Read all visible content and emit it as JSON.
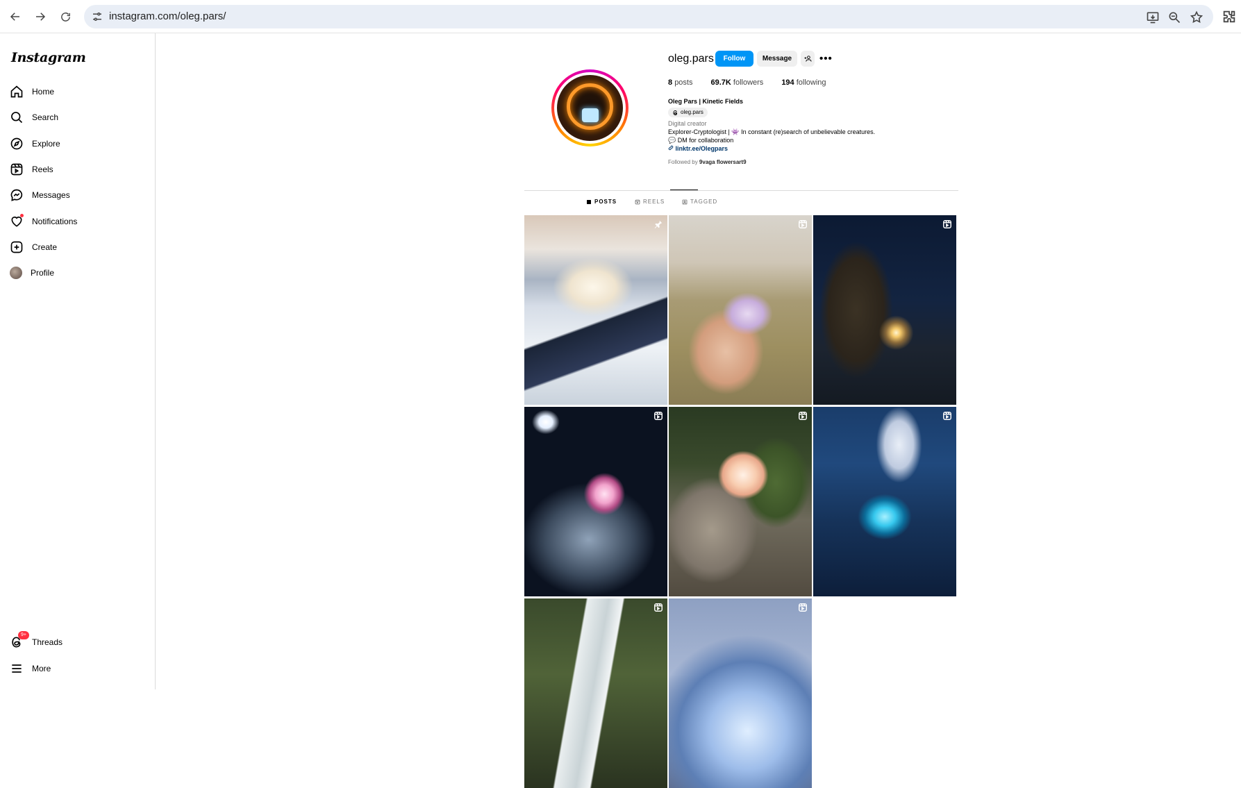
{
  "browser": {
    "url": "instagram.com/oleg.pars/"
  },
  "sidebar": {
    "logo": "Instagram",
    "items": [
      {
        "label": "Home"
      },
      {
        "label": "Search"
      },
      {
        "label": "Explore"
      },
      {
        "label": "Reels"
      },
      {
        "label": "Messages"
      },
      {
        "label": "Notifications"
      },
      {
        "label": "Create"
      },
      {
        "label": "Profile"
      }
    ],
    "threads": {
      "label": "Threads",
      "badge": "9+"
    },
    "more": {
      "label": "More"
    }
  },
  "profile": {
    "username": "oleg.pars",
    "follow_label": "Follow",
    "message_label": "Message",
    "add_label": "+A",
    "more_label": "•••",
    "stats": {
      "posts_count": "8",
      "posts_label": "posts",
      "followers_count": "69.7K",
      "followers_label": "followers",
      "following_count": "194",
      "following_label": "following"
    },
    "bio": {
      "name": "Oleg Pars | Kinetic Fields",
      "threads_handle": "oleg.pars",
      "category": "Digital creator",
      "line1": "Explorer-Cryptologist | 👾 In constant (re)search of unbelievable creatures.",
      "line2": "💬 DM for collaboration",
      "link": "linktr.ee/Olegpars",
      "followed_by_prefix": "Followed by",
      "followed_by_names": "9vaga flowersart9"
    }
  },
  "tabs": [
    {
      "label": "POSTS",
      "active": true
    },
    {
      "label": "REELS",
      "active": false
    },
    {
      "label": "TAGGED",
      "active": false
    }
  ],
  "posts": [
    {
      "icon": "pin-icon"
    },
    {
      "icon": "reel-icon"
    },
    {
      "icon": "reel-icon"
    },
    {
      "icon": "reel-icon"
    },
    {
      "icon": "reel-icon"
    },
    {
      "icon": "reel-icon"
    },
    {
      "icon": "reel-icon"
    },
    {
      "icon": "reel-icon"
    }
  ],
  "colors": {
    "accent": "#0095f6",
    "link": "#00376b",
    "notification": "#ff3040"
  }
}
